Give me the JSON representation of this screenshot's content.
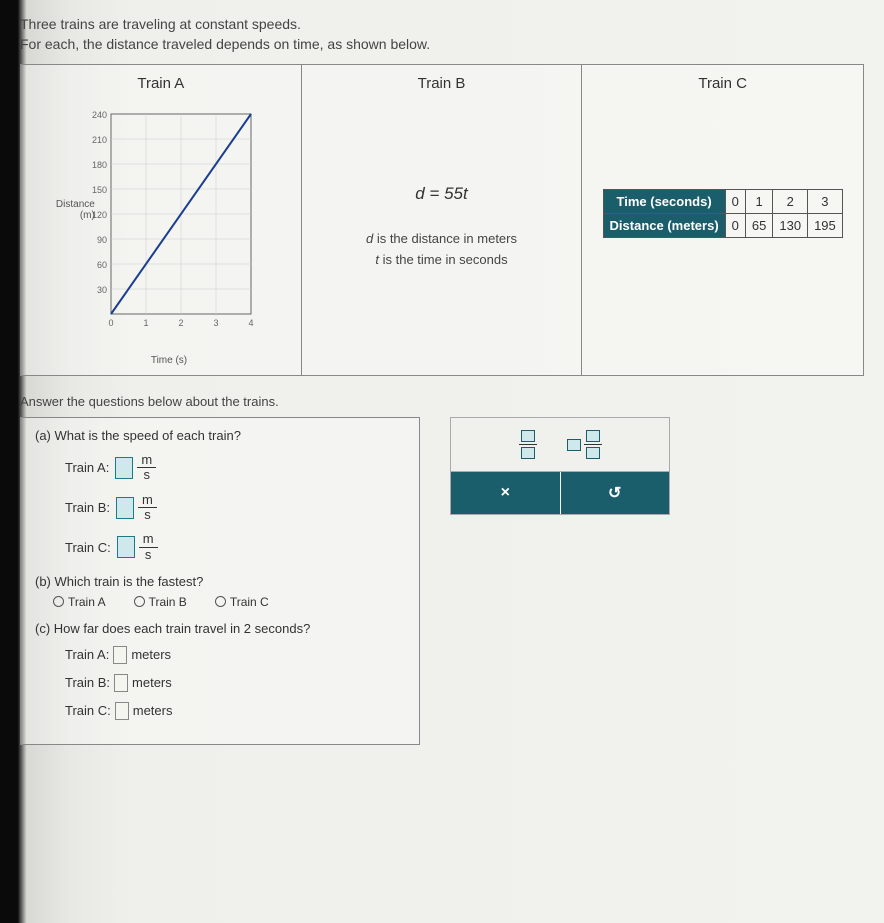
{
  "intro_line1": "Three trains are traveling at constant speeds.",
  "intro_line2": "For each, the distance traveled depends on time, as shown below.",
  "trainA": {
    "title": "Train A",
    "ylabel_l1": "Distance",
    "ylabel_l2": "(m)",
    "xlabel": "Time (s)"
  },
  "trainB": {
    "title": "Train B",
    "equation": "d = 55t",
    "desc1_pre": "d",
    "desc1_post": " is the distance in meters",
    "desc2_pre": "t",
    "desc2_post": " is the time in seconds"
  },
  "trainC": {
    "title": "Train C",
    "row_time": "Time (seconds)",
    "row_dist": "Distance (meters)",
    "times": [
      "0",
      "1",
      "2",
      "3"
    ],
    "dists": [
      "0",
      "65",
      "130",
      "195"
    ]
  },
  "answer_heading": "Answer the questions below about the trains.",
  "partA": {
    "q": "(a) What is the speed of each train?",
    "labels": {
      "a": "Train A:",
      "b": "Train B:",
      "c": "Train C:"
    },
    "unit_top": "m",
    "unit_bot": "s"
  },
  "partB": {
    "q": "(b) Which train is the fastest?",
    "opts": {
      "a": "Train A",
      "b": "Train B",
      "c": "Train C"
    }
  },
  "partC": {
    "q": "(c) How far does each train travel in 2 seconds?",
    "labels": {
      "a": "Train A:",
      "b": "Train B:",
      "c": "Train C:"
    },
    "unit": "meters"
  },
  "tools": {
    "close": "×",
    "reset": "↺"
  },
  "chart_data": {
    "type": "line",
    "title": "Train A",
    "xlabel": "Time (s)",
    "ylabel": "Distance (m)",
    "x": [
      0,
      1,
      2,
      3,
      4
    ],
    "values": [
      0,
      60,
      120,
      180,
      240
    ],
    "xlim": [
      0,
      4
    ],
    "ylim": [
      0,
      240
    ],
    "y_ticks": [
      30,
      60,
      90,
      120,
      150,
      180,
      210,
      240
    ],
    "x_ticks": [
      0,
      1,
      2,
      3,
      4
    ]
  }
}
